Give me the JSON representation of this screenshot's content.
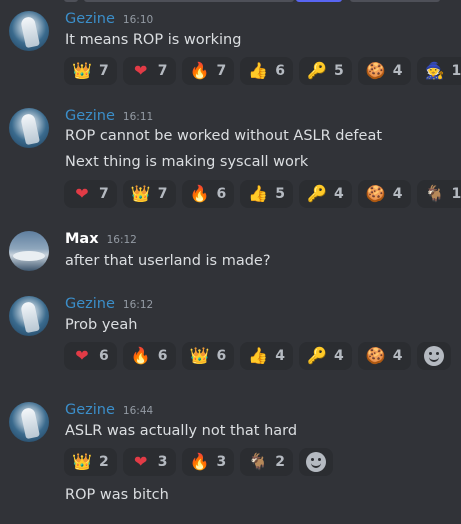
{
  "messages": [
    {
      "author": "Gezine",
      "time": "16:10",
      "lines": [
        "It means ROP is working"
      ],
      "reactions": [
        {
          "emoji": "crown-emoji",
          "glyph": "👑",
          "count": "7"
        },
        {
          "emoji": "heart-emoji",
          "glyph": "❤",
          "count": "7"
        },
        {
          "emoji": "fire-emoji",
          "glyph": "🔥",
          "count": "7"
        },
        {
          "emoji": "thumbs-up-emoji",
          "glyph": "👍",
          "count": "6"
        },
        {
          "emoji": "key-emoji",
          "glyph": "🔑",
          "count": "5"
        },
        {
          "emoji": "cookie-emoji",
          "glyph": "🍪",
          "count": "4"
        },
        {
          "emoji": "wizard-emoji",
          "glyph": "🧙",
          "count": "1"
        }
      ]
    },
    {
      "author": "Gezine",
      "time": "16:11",
      "lines": [
        "ROP cannot be worked without ASLR defeat",
        "Next thing is making syscall work"
      ],
      "reactions": [
        {
          "emoji": "heart-emoji",
          "glyph": "❤",
          "count": "7"
        },
        {
          "emoji": "crown-emoji",
          "glyph": "👑",
          "count": "7"
        },
        {
          "emoji": "fire-emoji",
          "glyph": "🔥",
          "count": "6"
        },
        {
          "emoji": "thumbs-up-emoji",
          "glyph": "👍",
          "count": "5"
        },
        {
          "emoji": "key-emoji",
          "glyph": "🔑",
          "count": "4"
        },
        {
          "emoji": "cookie-emoji",
          "glyph": "🍪",
          "count": "4"
        },
        {
          "emoji": "goat-emoji",
          "glyph": "🐐",
          "count": "1"
        }
      ]
    },
    {
      "author": "Max",
      "time": "16:12",
      "lines": [
        "after that userland is made?"
      ],
      "reactions": []
    },
    {
      "author": "Gezine",
      "time": "16:12",
      "lines": [
        "Prob yeah"
      ],
      "reactions": [
        {
          "emoji": "heart-emoji",
          "glyph": "❤",
          "count": "6"
        },
        {
          "emoji": "fire-emoji",
          "glyph": "🔥",
          "count": "6"
        },
        {
          "emoji": "crown-emoji",
          "glyph": "👑",
          "count": "6"
        },
        {
          "emoji": "thumbs-up-emoji",
          "glyph": "👍",
          "count": "4"
        },
        {
          "emoji": "key-emoji",
          "glyph": "🔑",
          "count": "4"
        },
        {
          "emoji": "cookie-emoji",
          "glyph": "🍪",
          "count": "4"
        }
      ]
    },
    {
      "author": "Gezine",
      "time": "16:44",
      "lines": [
        "ASLR was actually not that hard",
        "ROP was bitch"
      ],
      "reactions": [
        {
          "emoji": "crown-emoji",
          "glyph": "👑",
          "count": "2"
        },
        {
          "emoji": "heart-emoji",
          "glyph": "❤",
          "count": "3"
        },
        {
          "emoji": "fire-emoji",
          "glyph": "🔥",
          "count": "3"
        },
        {
          "emoji": "goat-emoji",
          "glyph": "🐐",
          "count": "2"
        }
      ]
    }
  ],
  "colors": {
    "background": "#313338",
    "gezine_name": "#3b8ec9",
    "max_name": "#ffffff",
    "reaction_bg": "#2b2d31",
    "text": "#dbdee1",
    "muted": "#949ba4"
  }
}
